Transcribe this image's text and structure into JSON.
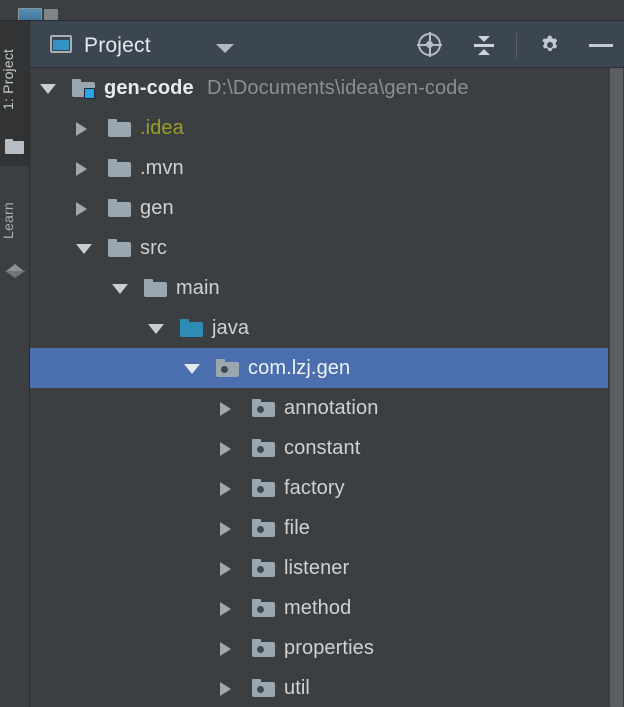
{
  "colors": {
    "panel_header_bg": "#3c4552",
    "tree_bg": "#3c3f41",
    "selection_blue": "#4b6eaf",
    "source_folder": "#2d8cb3",
    "module_badge": "#2aa3e8",
    "excluded_text": "#9c9e26",
    "path_text": "#8a8f93",
    "strip_active_bg": "#313335"
  },
  "tool_strip": {
    "tabs": [
      {
        "label": "1: Project",
        "icon": "folder-icon",
        "active": true
      },
      {
        "label": "Learn",
        "icon": "graduation-cap-icon",
        "active": false
      }
    ]
  },
  "panel_header": {
    "icon": "project-panel-icon",
    "title": "Project",
    "dropdown_icon": "chevron-down-icon",
    "buttons": [
      {
        "name": "locate-in-tree-button",
        "icon": "crosshair-icon"
      },
      {
        "name": "collapse-all-button",
        "icon": "collapse-all-icon"
      },
      {
        "name": "settings-button",
        "icon": "gear-icon"
      },
      {
        "name": "hide-panel-button",
        "icon": "minimize-icon"
      }
    ]
  },
  "tree": {
    "rows": [
      {
        "name": "gen-code",
        "secondary": "D:\\Documents\\idea\\gen-code",
        "depth": 0,
        "expander": "down",
        "icon": "module",
        "style": "bold",
        "selected": false
      },
      {
        "name": ".idea",
        "secondary": "",
        "depth": 1,
        "expander": "right",
        "icon": "folder",
        "style": "excluded",
        "selected": false
      },
      {
        "name": ".mvn",
        "secondary": "",
        "depth": 1,
        "expander": "right",
        "icon": "folder",
        "style": "normal",
        "selected": false
      },
      {
        "name": "gen",
        "secondary": "",
        "depth": 1,
        "expander": "right",
        "icon": "folder",
        "style": "normal",
        "selected": false
      },
      {
        "name": "src",
        "secondary": "",
        "depth": 1,
        "expander": "down",
        "icon": "folder",
        "style": "normal",
        "selected": false
      },
      {
        "name": "main",
        "secondary": "",
        "depth": 2,
        "expander": "down",
        "icon": "folder",
        "style": "normal",
        "selected": false
      },
      {
        "name": "java",
        "secondary": "",
        "depth": 3,
        "expander": "down",
        "icon": "source",
        "style": "normal",
        "selected": false
      },
      {
        "name": "com.lzj.gen",
        "secondary": "",
        "depth": 4,
        "expander": "down",
        "icon": "package",
        "style": "normal",
        "selected": true
      },
      {
        "name": "annotation",
        "secondary": "",
        "depth": 5,
        "expander": "right",
        "icon": "package",
        "style": "normal",
        "selected": false
      },
      {
        "name": "constant",
        "secondary": "",
        "depth": 5,
        "expander": "right",
        "icon": "package",
        "style": "normal",
        "selected": false
      },
      {
        "name": "factory",
        "secondary": "",
        "depth": 5,
        "expander": "right",
        "icon": "package",
        "style": "normal",
        "selected": false
      },
      {
        "name": "file",
        "secondary": "",
        "depth": 5,
        "expander": "right",
        "icon": "package",
        "style": "normal",
        "selected": false
      },
      {
        "name": "listener",
        "secondary": "",
        "depth": 5,
        "expander": "right",
        "icon": "package",
        "style": "normal",
        "selected": false
      },
      {
        "name": "method",
        "secondary": "",
        "depth": 5,
        "expander": "right",
        "icon": "package",
        "style": "normal",
        "selected": false
      },
      {
        "name": "properties",
        "secondary": "",
        "depth": 5,
        "expander": "right",
        "icon": "package",
        "style": "normal",
        "selected": false
      },
      {
        "name": "util",
        "secondary": "",
        "depth": 5,
        "expander": "right",
        "icon": "package",
        "style": "normal",
        "selected": false
      }
    ]
  },
  "scrollbar": {
    "name": "vertical-scrollbar"
  }
}
